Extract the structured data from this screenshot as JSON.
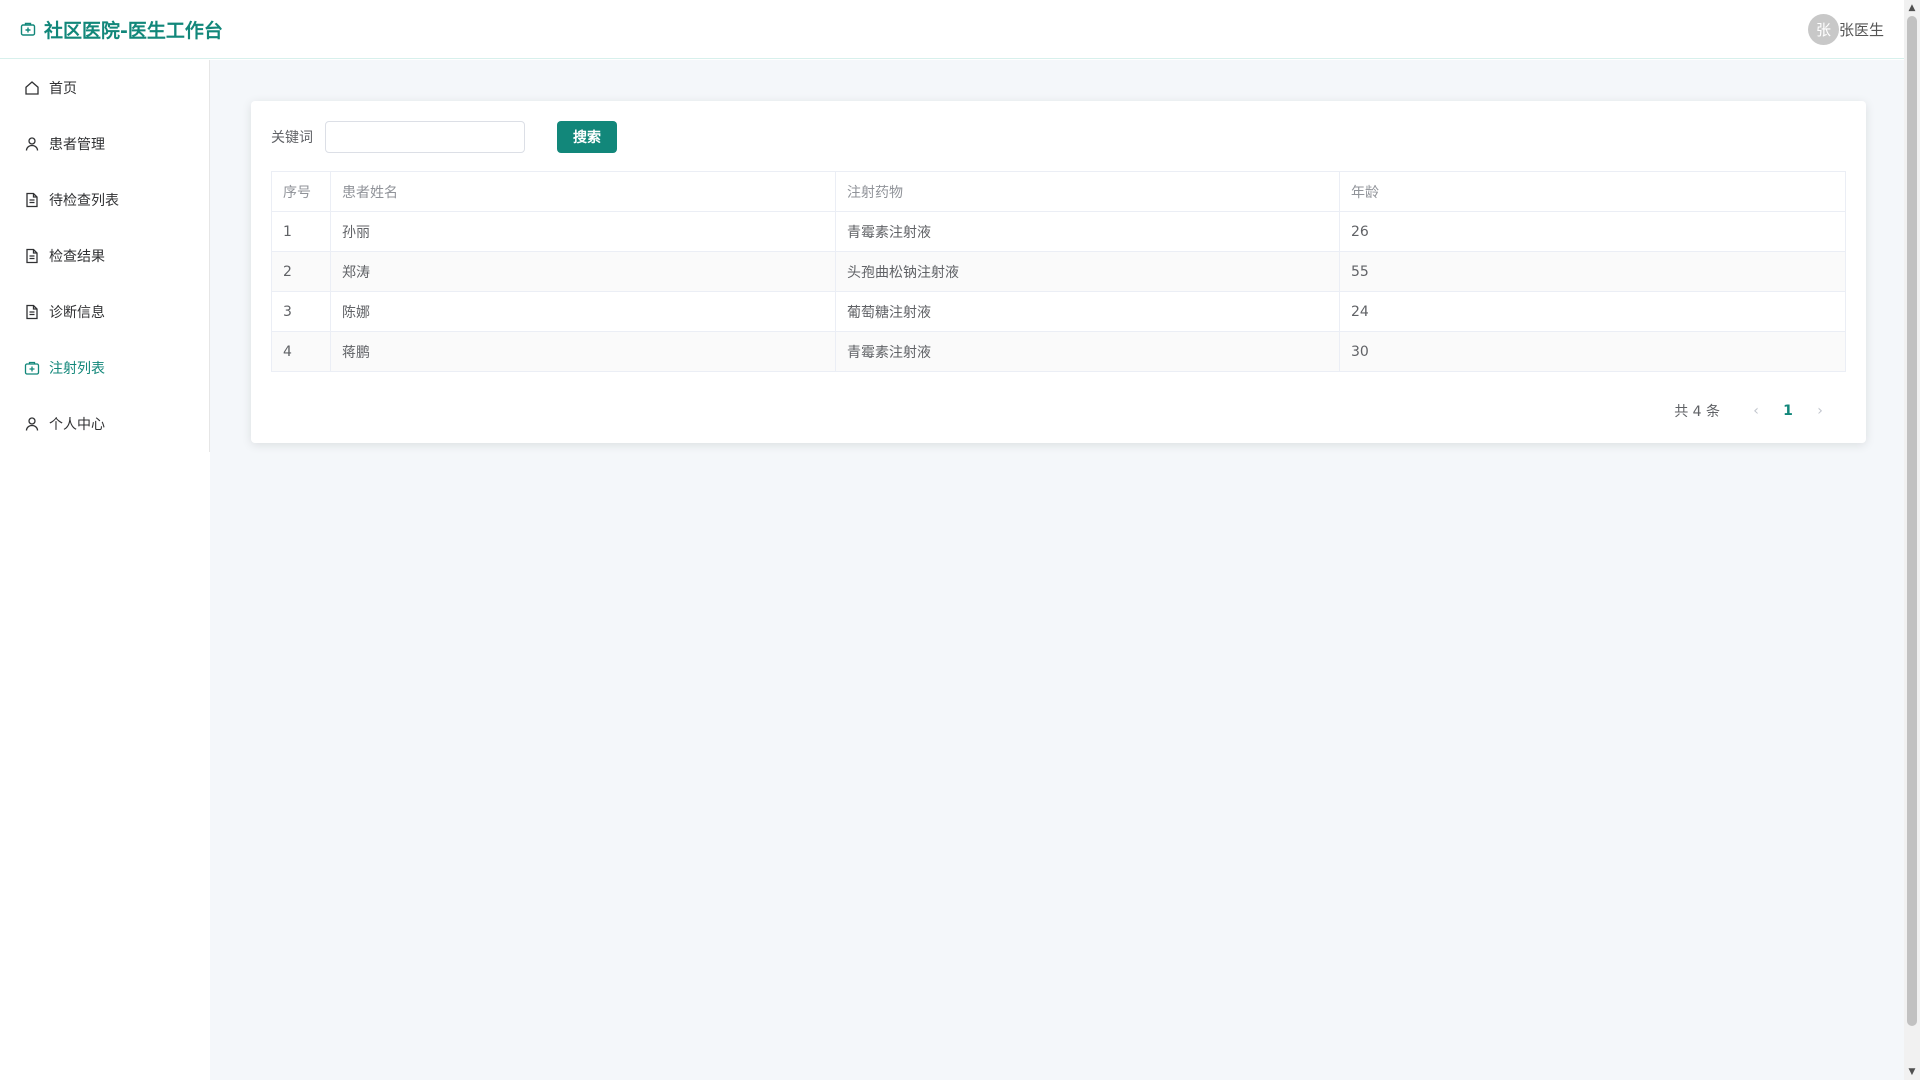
{
  "header": {
    "title": "社区医院-医生工作台",
    "avatar_text": "张",
    "user_name": "张医生",
    "brand_color": "#12877a"
  },
  "sidebar": {
    "items": [
      {
        "label": "首页",
        "icon": "home-icon"
      },
      {
        "label": "患者管理",
        "icon": "user-icon"
      },
      {
        "label": "待检查列表",
        "icon": "document-icon"
      },
      {
        "label": "检查结果",
        "icon": "document-icon"
      },
      {
        "label": "诊断信息",
        "icon": "document-icon"
      },
      {
        "label": "注射列表",
        "icon": "first-aid-kit-icon",
        "active": true
      },
      {
        "label": "个人中心",
        "icon": "user-icon"
      }
    ]
  },
  "search": {
    "label": "关键词",
    "value": "",
    "placeholder": "",
    "button_label": "搜索"
  },
  "table": {
    "headers": [
      "序号",
      "患者姓名",
      "注射药物",
      "年龄"
    ],
    "rows": [
      [
        "1",
        "孙丽",
        "青霉素注射液",
        "26"
      ],
      [
        "2",
        "郑涛",
        "头孢曲松钠注射液",
        "55"
      ],
      [
        "3",
        "陈娜",
        "葡萄糖注射液",
        "24"
      ],
      [
        "4",
        "蒋鹏",
        "青霉素注射液",
        "30"
      ]
    ]
  },
  "pagination": {
    "total_text": "共 4 条",
    "current_page": "1",
    "prev": "‹",
    "next": "›"
  }
}
